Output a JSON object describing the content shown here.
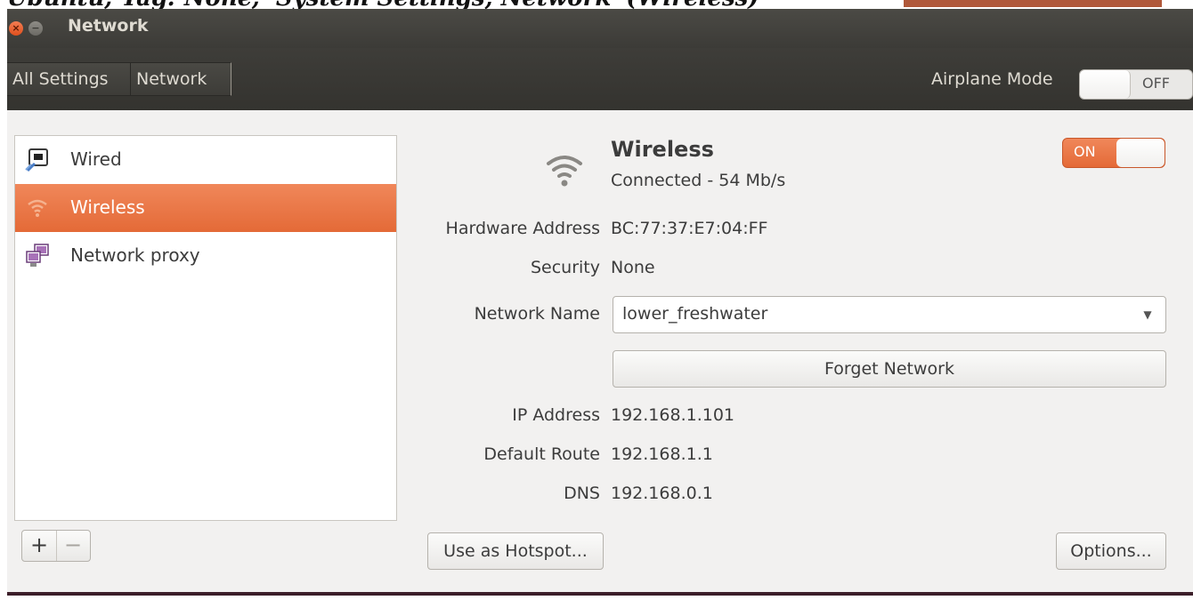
{
  "caption": "Ubuntu; Tag: None; 'System Settings, Network' (Wireless)",
  "window": {
    "title": "Network",
    "close_glyph": "×",
    "minimize_glyph": "−"
  },
  "toolbar": {
    "breadcrumb_all": "All Settings",
    "breadcrumb_current": "Network",
    "airplane_label": "Airplane Mode",
    "airplane_state": "OFF"
  },
  "sidebar": {
    "items": [
      {
        "label": "Wired",
        "icon": "wired-network-icon",
        "selected": false
      },
      {
        "label": "Wireless",
        "icon": "wifi-icon",
        "selected": true
      },
      {
        "label": "Network proxy",
        "icon": "network-proxy-icon",
        "selected": false
      }
    ],
    "add_label": "+",
    "remove_label": "−"
  },
  "device": {
    "title": "Wireless",
    "status": "Connected - 54 Mb/s",
    "switch_state": "ON",
    "icon": "wifi-signal-icon"
  },
  "details": {
    "hardware_address_label": "Hardware Address",
    "hardware_address": "BC:77:37:E7:04:FF",
    "security_label": "Security",
    "security": "None",
    "network_name_label": "Network Name",
    "network_name": "lower_freshwater",
    "forget_button": "Forget Network",
    "ip_label": "IP Address",
    "ip": "192.168.1.101",
    "route_label": "Default Route",
    "route": "192.168.1.1",
    "dns_label": "DNS",
    "dns": "192.168.0.1"
  },
  "footer": {
    "hotspot_button": "Use as Hotspot...",
    "options_button": "Options..."
  },
  "colors": {
    "accent": "#e9703e",
    "titlebar": "#3c3b37",
    "window_bg": "#f2f1f0"
  }
}
